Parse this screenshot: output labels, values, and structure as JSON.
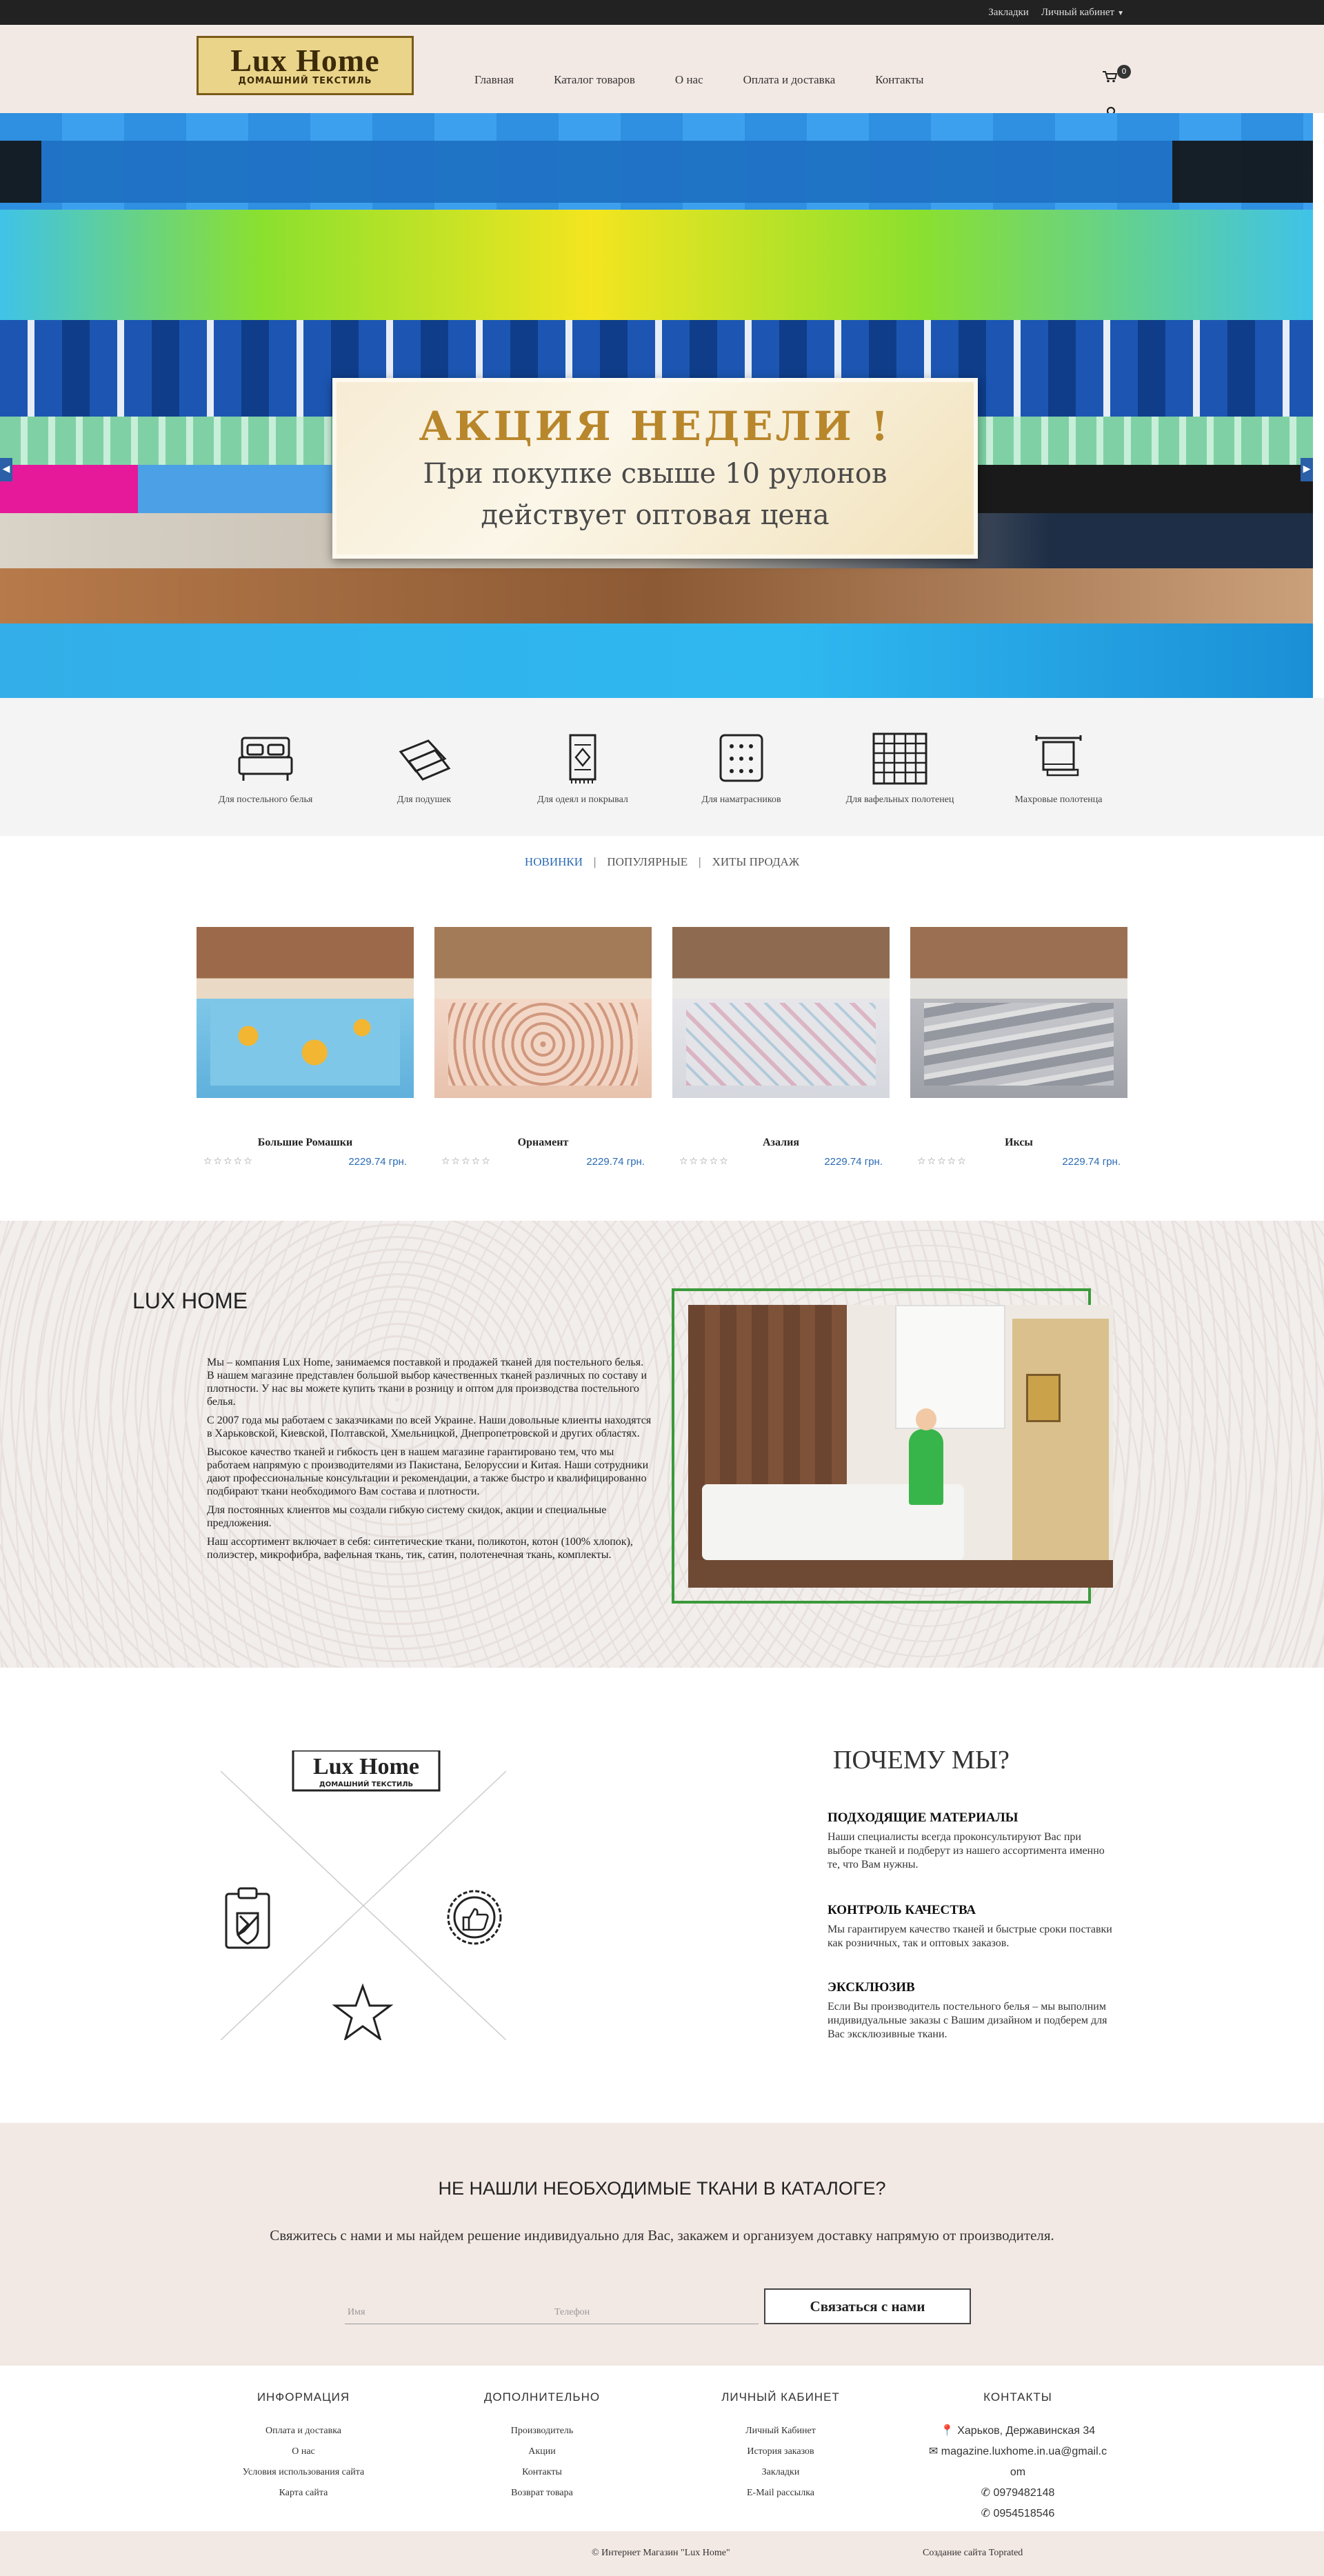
{
  "topbar": {
    "bookmarks": "Закладки",
    "account": "Личный кабинет"
  },
  "header": {
    "logo_main": "Lux Home",
    "logo_sub": "ДОМАШНИЙ ТЕКСТИЛЬ",
    "nav": [
      "Главная",
      "Каталог товаров",
      "О нас",
      "Оплата и доставка",
      "Контакты"
    ],
    "cart_count": "0"
  },
  "slider": {
    "title": "АКЦИЯ НЕДЕЛИ !",
    "text_line1": "При покупке свыше 10 рулонов",
    "text_line2": "действует оптовая цена"
  },
  "categories": [
    {
      "label": "Для постельного белья",
      "icon": "bed-icon"
    },
    {
      "label": "Для подушек",
      "icon": "pillow-icon"
    },
    {
      "label": "Для одеял и покрывал",
      "icon": "blanket-icon"
    },
    {
      "label": "Для наматрасников",
      "icon": "mattress-icon"
    },
    {
      "label": "Для вафельных полотенец",
      "icon": "waffle-towel-icon"
    },
    {
      "label": "Махровые полотенца",
      "icon": "towel-rail-icon"
    }
  ],
  "tabs": [
    "НОВИНКИ",
    "ПОПУЛЯРНЫЕ",
    "ХИТЫ ПРОДАЖ"
  ],
  "products": [
    {
      "name": "Большие Ромашки",
      "price": "2229.74 грн.",
      "stars": "☆☆☆☆☆",
      "color": "#7fc7e8",
      "accent": "#f2b632"
    },
    {
      "name": "Орнамент",
      "price": "2229.74 грн.",
      "stars": "☆☆☆☆☆",
      "color": "#f3d8c8",
      "accent": "#c98a6e"
    },
    {
      "name": "Азалия",
      "price": "2229.74 грн.",
      "stars": "☆☆☆☆☆",
      "color": "#e6e6ea",
      "accent": "#d9a2b4"
    },
    {
      "name": "Иксы",
      "price": "2229.74 грн.",
      "stars": "☆☆☆☆☆",
      "color": "#b8babf",
      "accent": "#e7e7e7"
    }
  ],
  "about": {
    "title": "LUX HOME",
    "paragraphs": [
      "Мы – компания Lux Home, занимаемся поставкой и продажей тканей для постельного белья. В нашем магазине представлен большой выбор качественных тканей различных по составу и плотности. У нас вы можете купить ткани в розницу и оптом для производства постельного белья.",
      "С 2007 года мы работаем с заказчиками по всей Украине. Наши довольные клиенты находятся в Харьковской, Киевской, Полтавской, Хмельницкой, Днепропетровской и других областях.",
      "Высокое качество тканей и гибкость цен в нашем магазине гарантировано тем, что мы работаем напрямую с производителями из Пакистана, Белоруссии и Китая. Наши сотрудники дают профессиональные консультации и рекомендации, а также быстро и квалифицированно подбирают ткани необходимого Вам состава и плотности.",
      "Для постоянных клиентов мы создали гибкую систему скидок, акции и специальные предложения.",
      "Наш ассортимент включает в себя: синтетические ткани, поликотон, котон (100% хлопок), полиэстер, микрофибра, вафельная ткань, тик, сатин, полотенечная ткань, комплекты."
    ]
  },
  "why": {
    "logo_main": "Lux Home",
    "logo_sub": "ДОМАШНИЙ ТЕКСТИЛЬ",
    "title": "ПОЧЕМУ МЫ?",
    "items": [
      {
        "heading": "ПОДХОДЯЩИЕ МАТЕРИАЛЫ",
        "text": "Наши специалисты всегда проконсультируют Вас при выборе тканей и подберут из нашего ассортимента именно те, что Вам нужны."
      },
      {
        "heading": "КОНТРОЛЬ КАЧЕСТВА",
        "text": "Мы гарантируем качество тканей и быстрые сроки поставки как розничных, так и оптовых заказов."
      },
      {
        "heading": "ЭКСКЛЮЗИВ",
        "text": "Если Вы производитель постельного белья – мы выполним индивидуальные заказы с Вашим дизайном и подберем для Вас эксклюзивные ткани."
      }
    ]
  },
  "contact": {
    "title": "НЕ НАШЛИ НЕОБХОДИМЫЕ ТКАНИ В КАТАЛОГЕ?",
    "text": "Свяжитесь с нами и мы найдем решение индивидуально для Вас, закажем и организуем доставку напрямую от производителя.",
    "name_placeholder": "Имя",
    "phone_placeholder": "Телефон",
    "button": "Связаться с нами"
  },
  "footer": {
    "info": {
      "title": "ИНФОРМАЦИЯ",
      "links": [
        "Оплата и доставка",
        "О нас",
        "Условия использования сайта",
        "Карта сайта"
      ]
    },
    "extra": {
      "title": "ДОПОЛНИТЕЛЬНО",
      "links": [
        "Производитель",
        "Акции",
        "Контакты",
        "Возврат товара"
      ]
    },
    "account": {
      "title": "ЛИЧНЫЙ КАБИНЕТ",
      "links": [
        "Личный Кабинет",
        "История заказов",
        "Закладки",
        "E-Mail рассылка"
      ]
    },
    "contacts": {
      "title": "КОНТАКТЫ",
      "address": "Харьков, Державинская 34",
      "email_line1": "magazine.luxhome.in.ua@gmail.c",
      "email_line2": "om",
      "phone1": "0979482148",
      "phone2": "0954518546"
    },
    "copyright": "© Интернет Магазин \"Lux Home\"",
    "made_by": "Создание сайта Toprated"
  }
}
